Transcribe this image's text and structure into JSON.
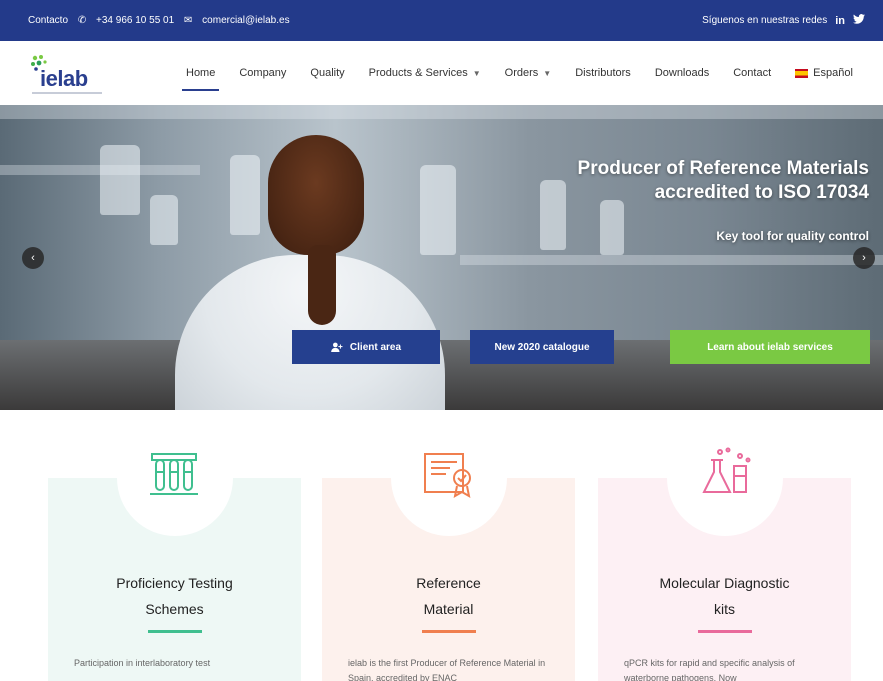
{
  "topbar": {
    "contact_label": "Contacto",
    "phone": "+34 966 10 55 01",
    "email": "comercial@ielab.es",
    "social_label": "Síguenos en nuestras redes",
    "linkedin": "in"
  },
  "logo": {
    "word": "ielab"
  },
  "nav": {
    "items": [
      {
        "label": "Home",
        "active": true
      },
      {
        "label": "Company"
      },
      {
        "label": "Quality"
      },
      {
        "label": "Products & Services"
      },
      {
        "label": "Orders"
      },
      {
        "label": "Distributors"
      },
      {
        "label": "Downloads"
      },
      {
        "label": "Contact"
      },
      {
        "label": "Español"
      }
    ],
    "caret": "▼"
  },
  "hero": {
    "title_line1": "Producer of Reference Materials",
    "title_line2": "accredited to ISO 17034",
    "subtitle": "Key tool for quality control",
    "prev": "‹",
    "next": "›",
    "buttons": {
      "client_area": "Client area",
      "catalogue": "New 2020 catalogue",
      "services": "Learn about ielab services"
    }
  },
  "cards": [
    {
      "title_line1": "Proficiency Testing",
      "title_line2": "Schemes",
      "desc": "Participation in interlaboratory test",
      "accent": "#3fbf8f",
      "bg": "#eef8f5"
    },
    {
      "title_line1": "Reference",
      "title_line2": "Material",
      "desc": "ielab is the first Producer of Reference Material in Spain, accredited by ENAC",
      "accent": "#f07f4f",
      "bg": "#fdf1ed"
    },
    {
      "title_line1": "Molecular Diagnostic",
      "title_line2": "kits",
      "desc": "qPCR kits for rapid and specific analysis of waterborne pathogens. Now",
      "accent": "#e96a9b",
      "bg": "#fdf0f4"
    }
  ],
  "colors": {
    "brand_blue": "#233a8a",
    "cta_green": "#7ac943"
  }
}
